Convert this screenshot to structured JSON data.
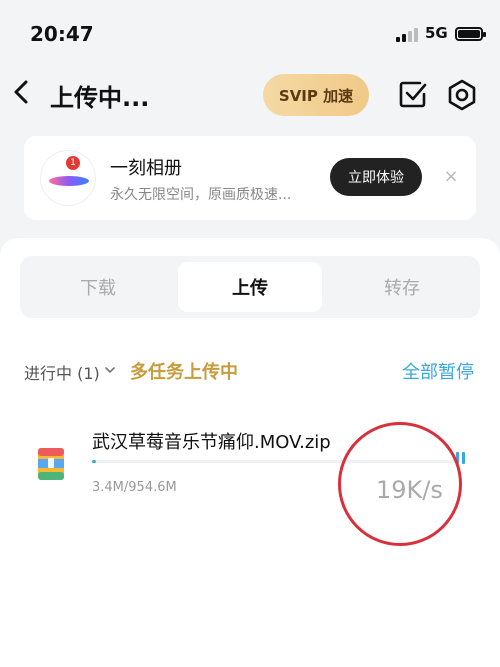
{
  "status_bar": {
    "time": "20:47",
    "network": "5G"
  },
  "nav": {
    "title": "上传中...",
    "svip_label": "SVIP 加速"
  },
  "promo": {
    "badge": "1",
    "title": "一刻相册",
    "subtitle": "永久无限空间，原画质极速...",
    "action_label": "立即体验",
    "close_label": "×"
  },
  "tabs": [
    {
      "label": "下载",
      "active": false
    },
    {
      "label": "上传",
      "active": true
    },
    {
      "label": "转存",
      "active": false
    }
  ],
  "filter": {
    "status_label": "进行中 (1)",
    "multi_task_label": "多任务上传中",
    "pause_all_label": "全部暂停"
  },
  "upload": {
    "file_name": "武汉草莓音乐节痛仰.MOV.zip",
    "size_progress": "3.4M/954.6M",
    "speed": "19K/s",
    "progress_fraction": 0.0036
  },
  "colors": {
    "accent_blue": "#3aa8e0",
    "gold": "#c89b3c",
    "annotation_red": "#d9313b"
  }
}
